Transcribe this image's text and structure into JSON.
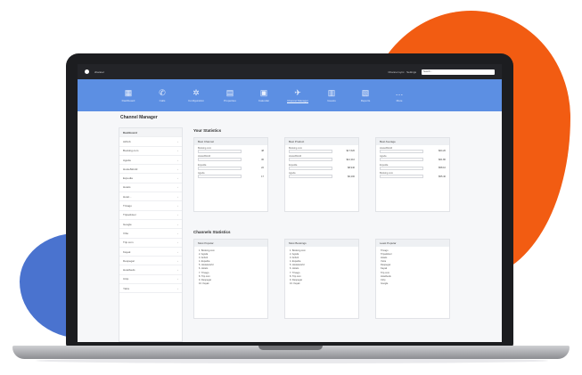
{
  "app": {
    "brand": "channel",
    "top_links": "Channel sync · Settings",
    "search_placeholder": "Search..."
  },
  "nav": [
    {
      "icon": "dashboard-icon",
      "glyph": "▦",
      "label": "Dashboard"
    },
    {
      "icon": "phone-icon",
      "glyph": "✆",
      "label": "Calls"
    },
    {
      "icon": "gear-icon",
      "glyph": "✲",
      "label": "Configuration"
    },
    {
      "icon": "building-icon",
      "glyph": "▤",
      "label": "Properties"
    },
    {
      "icon": "calendar-icon",
      "glyph": "▣",
      "label": "Calendar"
    },
    {
      "icon": "plane-icon",
      "glyph": "✈",
      "label": "Channel Manager"
    },
    {
      "icon": "guests-icon",
      "glyph": "▥",
      "label": "Guests"
    },
    {
      "icon": "report-icon",
      "glyph": "▧",
      "label": "Reports"
    },
    {
      "icon": "more-icon",
      "glyph": "…",
      "label": "More"
    }
  ],
  "page_title": "Channel Manager",
  "sidebar": [
    "Dashboard",
    "Airbnb",
    "Booking.com",
    "Agoda",
    "HostelWorld",
    "Expedia",
    "Hotels",
    "Hotel...",
    "Trivago",
    "Tripadvisor",
    "Google",
    "Vrbo",
    "Trip.com",
    "Kayak",
    "Despegar",
    "Hotelbeds",
    "Ctrip",
    "Yatra"
  ],
  "sections": {
    "stats_title": "Your Statistics",
    "ranking_title": "Channels Statistics"
  },
  "stat_cards": [
    {
      "title": "Best Channel",
      "rows": [
        {
          "label": "Booking.com",
          "value": "48"
        },
        {
          "label": "HostelWorld",
          "value": "36"
        },
        {
          "label": "Expedia",
          "value": "22"
        },
        {
          "label": "Agoda",
          "value": "17"
        }
      ]
    },
    {
      "title": "Best Product",
      "rows": [
        {
          "label": "Booking.com",
          "value": "$17,520"
        },
        {
          "label": "HostelWorld",
          "value": "$12,310"
        },
        {
          "label": "Expedia",
          "value": "$8,940"
        },
        {
          "label": "Agoda",
          "value": "$6,200"
        }
      ]
    },
    {
      "title": "Best Average",
      "rows": [
        {
          "label": "HostelWorld",
          "value": "$64.20"
        },
        {
          "label": "Agoda",
          "value": "$61.80"
        },
        {
          "label": "Expedia",
          "value": "$58.10"
        },
        {
          "label": "Booking.com",
          "value": "$55.40"
        }
      ]
    }
  ],
  "rank_cards": [
    {
      "title": "Most Popular",
      "items": [
        "1. Booking.com",
        "2. Agoda",
        "3. Airbnb",
        "4. Expedia",
        "5. Hostelworld",
        "6. Hotels",
        "7. Trivago",
        "8. Trip.com",
        "9. Despegar",
        "10. Kayak"
      ]
    },
    {
      "title": "Most Bookings",
      "items": [
        "1. Booking.com",
        "2. Agoda",
        "3. Airbnb",
        "4. Expedia",
        "5. Hostelworld",
        "6. Hotels",
        "7. Trivago",
        "8. Trip.com",
        "9. Despegar",
        "10. Kayak"
      ]
    },
    {
      "title": "Least Popular",
      "items": [
        "Trivago",
        "Tripadvisor",
        "Hotels",
        "Yatra",
        "Despegar",
        "Kayak",
        "Trip.com",
        "Hotelbeds",
        "Ctrip",
        "Google"
      ]
    }
  ],
  "colors": {
    "nav": "#5c8fe3",
    "blob_orange": "#f25c12",
    "blob_blue": "#4a73cf"
  }
}
